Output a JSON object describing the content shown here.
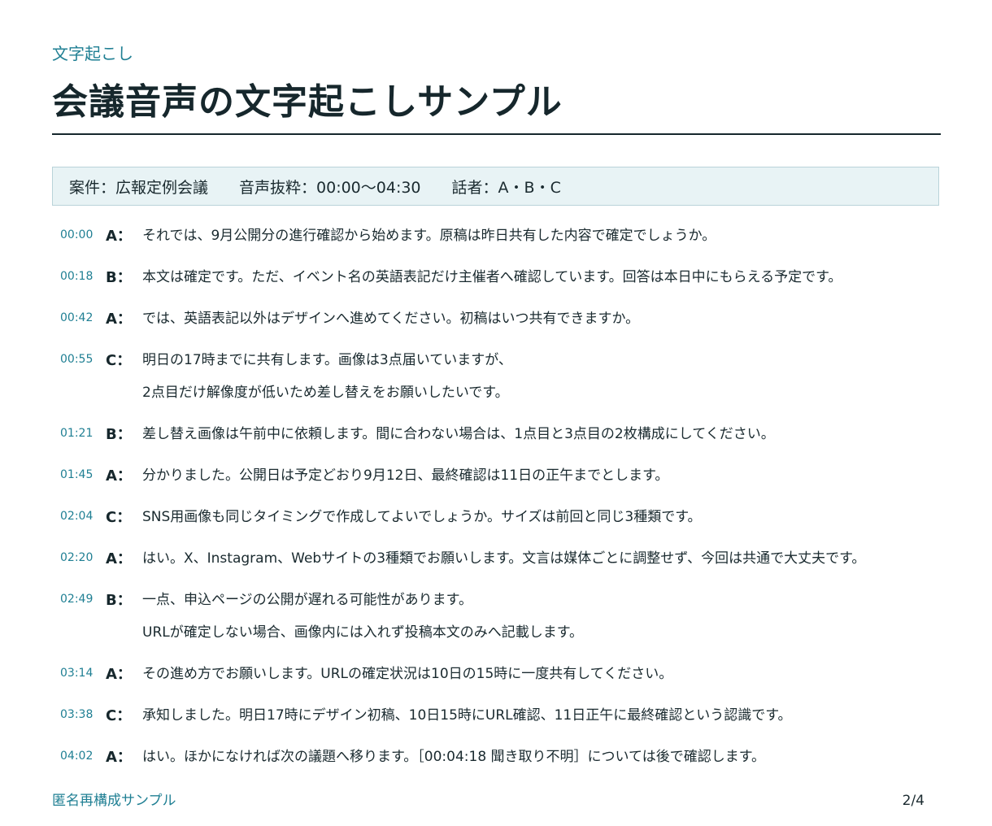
{
  "header": {
    "kicker": "文字起こし",
    "title": "会議音声の文字起こしサンプル"
  },
  "meta": {
    "case": "案件：広報定例会議",
    "excerpt": "音声抜粋：00:00〜04:30",
    "speakers": "話者：A・B・C"
  },
  "utterances": [
    {
      "time": "00:00",
      "speaker": "A：",
      "lines": [
        "それでは、9月公開分の進行確認から始めます。原稿は昨日共有した内容で確定でしょうか。"
      ]
    },
    {
      "time": "00:18",
      "speaker": "B：",
      "lines": [
        "本文は確定です。ただ、イベント名の英語表記だけ主催者へ確認しています。回答は本日中にもらえる予定です。"
      ]
    },
    {
      "time": "00:42",
      "speaker": "A：",
      "lines": [
        "では、英語表記以外はデザインへ進めてください。初稿はいつ共有できますか。"
      ]
    },
    {
      "time": "00:55",
      "speaker": "C：",
      "lines": [
        "明日の17時までに共有します。画像は3点届いていますが、",
        "2点目だけ解像度が低いため差し替えをお願いしたいです。"
      ]
    },
    {
      "time": "01:21",
      "speaker": "B：",
      "lines": [
        "差し替え画像は午前中に依頼します。間に合わない場合は、1点目と3点目の2枚構成にしてください。"
      ]
    },
    {
      "time": "01:45",
      "speaker": "A：",
      "lines": [
        "分かりました。公開日は予定どおり9月12日、最終確認は11日の正午までとします。"
      ]
    },
    {
      "time": "02:04",
      "speaker": "C：",
      "lines": [
        "SNS用画像も同じタイミングで作成してよいでしょうか。サイズは前回と同じ3種類です。"
      ]
    },
    {
      "time": "02:20",
      "speaker": "A：",
      "lines": [
        "はい。X、Instagram、Webサイトの3種類でお願いします。文言は媒体ごとに調整せず、今回は共通で大丈夫です。"
      ]
    },
    {
      "time": "02:49",
      "speaker": "B：",
      "lines": [
        "一点、申込ページの公開が遅れる可能性があります。",
        "URLが確定しない場合、画像内には入れず投稿本文のみへ記載します。"
      ]
    },
    {
      "time": "03:14",
      "speaker": "A：",
      "lines": [
        "その進め方でお願いします。URLの確定状況は10日の15時に一度共有してください。"
      ]
    },
    {
      "time": "03:38",
      "speaker": "C：",
      "lines": [
        "承知しました。明日17時にデザイン初稿、10日15時にURL確認、11日正午に最終確認という認識です。"
      ]
    },
    {
      "time": "04:02",
      "speaker": "A：",
      "lines": [
        "はい。ほかになければ次の議題へ移ります。［00:04:18 聞き取り不明］については後で確認します。"
      ]
    }
  ],
  "footer": {
    "label": "匿名再構成サンプル",
    "page": "2/4"
  }
}
